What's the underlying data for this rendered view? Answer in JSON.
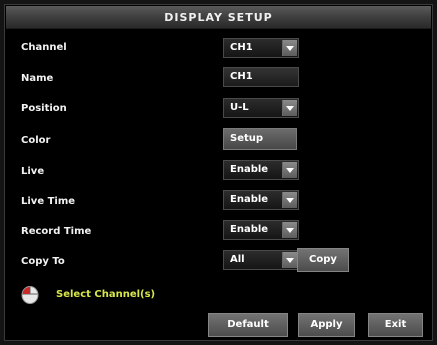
{
  "window": {
    "title": "DISPLAY SETUP"
  },
  "rows": [
    {
      "label": "Channel",
      "value": "CH1",
      "type": "select"
    },
    {
      "label": "Name",
      "value": "CH1",
      "type": "text"
    },
    {
      "label": "Position",
      "value": "U-L",
      "type": "select"
    },
    {
      "label": "Color",
      "value": "Setup",
      "type": "button"
    },
    {
      "label": "Live",
      "value": "Enable",
      "type": "select"
    },
    {
      "label": "Live Time",
      "value": "Enable",
      "type": "select"
    },
    {
      "label": "Record Time",
      "value": "Enable",
      "type": "select"
    },
    {
      "label": "Copy To",
      "value": "All",
      "type": "select"
    }
  ],
  "copy_button": "Copy",
  "hint": {
    "icon": "mouse-icon",
    "text": "Select Channel(s)"
  },
  "footer": {
    "default": "Default",
    "apply": "Apply",
    "exit": "Exit"
  }
}
